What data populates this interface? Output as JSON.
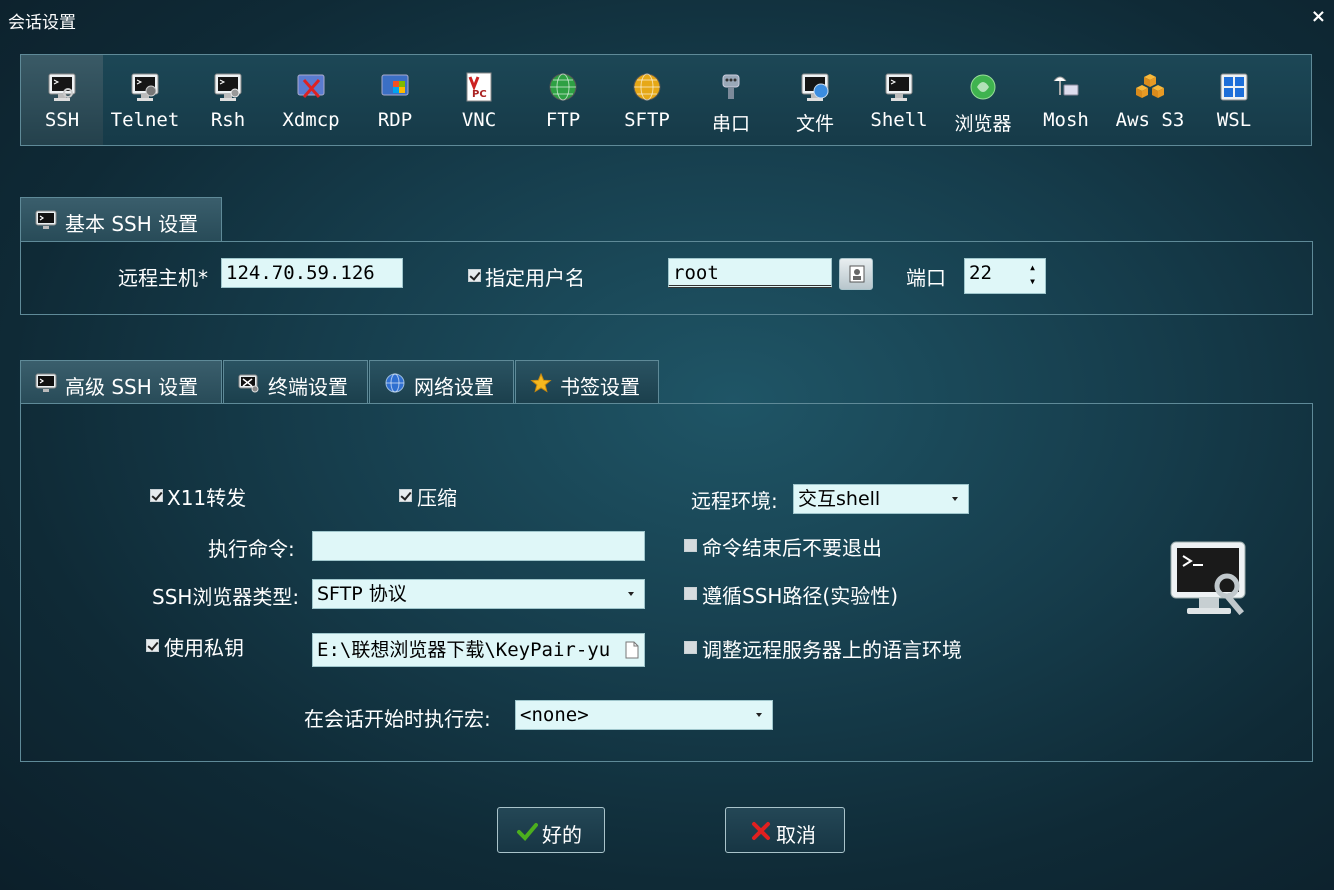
{
  "window": {
    "title": "会话设置",
    "close_icon": "close-icon"
  },
  "protocols": [
    {
      "label": "SSH",
      "icon": "ssh-terminal-icon",
      "active": true
    },
    {
      "label": "Telnet",
      "icon": "telnet-icon"
    },
    {
      "label": "Rsh",
      "icon": "rsh-icon"
    },
    {
      "label": "Xdmcp",
      "icon": "xdmcp-icon"
    },
    {
      "label": "RDP",
      "icon": "rdp-icon"
    },
    {
      "label": "VNC",
      "icon": "vnc-icon"
    },
    {
      "label": "FTP",
      "icon": "ftp-globe-icon"
    },
    {
      "label": "SFTP",
      "icon": "sftp-globe-icon"
    },
    {
      "label": "串口",
      "icon": "serial-plug-icon"
    },
    {
      "label": "文件",
      "icon": "file-icon"
    },
    {
      "label": "Shell",
      "icon": "shell-monitor-icon"
    },
    {
      "label": "浏览器",
      "icon": "browser-icon"
    },
    {
      "label": "Mosh",
      "icon": "mosh-satellite-icon"
    },
    {
      "label": "Aws S3",
      "icon": "aws-cubes-icon"
    },
    {
      "label": "WSL",
      "icon": "windows-icon"
    }
  ],
  "basic": {
    "tab_label": "基本 SSH 设置",
    "host_label": "远程主机*",
    "host_value": "124.70.59.126",
    "username_check_label": "指定用户名",
    "username_checked": true,
    "username_value": "root",
    "port_label": "端口",
    "port_value": "22"
  },
  "adv_tabs": [
    {
      "label": "高级 SSH 设置",
      "icon": "terminal-icon",
      "active": true
    },
    {
      "label": "终端设置",
      "icon": "terminal-settings-icon"
    },
    {
      "label": "网络设置",
      "icon": "network-globe-icon"
    },
    {
      "label": "书签设置",
      "icon": "star-icon"
    }
  ],
  "advanced": {
    "x11_label": "X11转发",
    "x11_checked": true,
    "compress_label": "压缩",
    "compress_checked": true,
    "remote_env_label": "远程环境:",
    "remote_env_value": "交互shell",
    "exec_cmd_label": "执行命令:",
    "exec_cmd_value": "",
    "no_exit_label": "命令结束后不要退出",
    "no_exit_checked": false,
    "browser_type_label": "SSH浏览器类型:",
    "browser_type_value": "SFTP 协议",
    "follow_path_label": "遵循SSH路径(实验性)",
    "follow_path_checked": false,
    "private_key_label": "使用私钥",
    "private_key_checked": true,
    "private_key_value": "E:\\联想浏览器下载\\KeyPair-yu",
    "adjust_locale_label": "调整远程服务器上的语言环境",
    "adjust_locale_checked": false,
    "macro_label": "在会话开始时执行宏:",
    "macro_value": "<none>"
  },
  "buttons": {
    "ok_label": "好的",
    "cancel_label": "取消"
  },
  "colors": {
    "field_bg": "#dff7f8",
    "border": "#5f8a98",
    "ok_check": "#4caf1e",
    "cancel_x": "#e02020"
  }
}
